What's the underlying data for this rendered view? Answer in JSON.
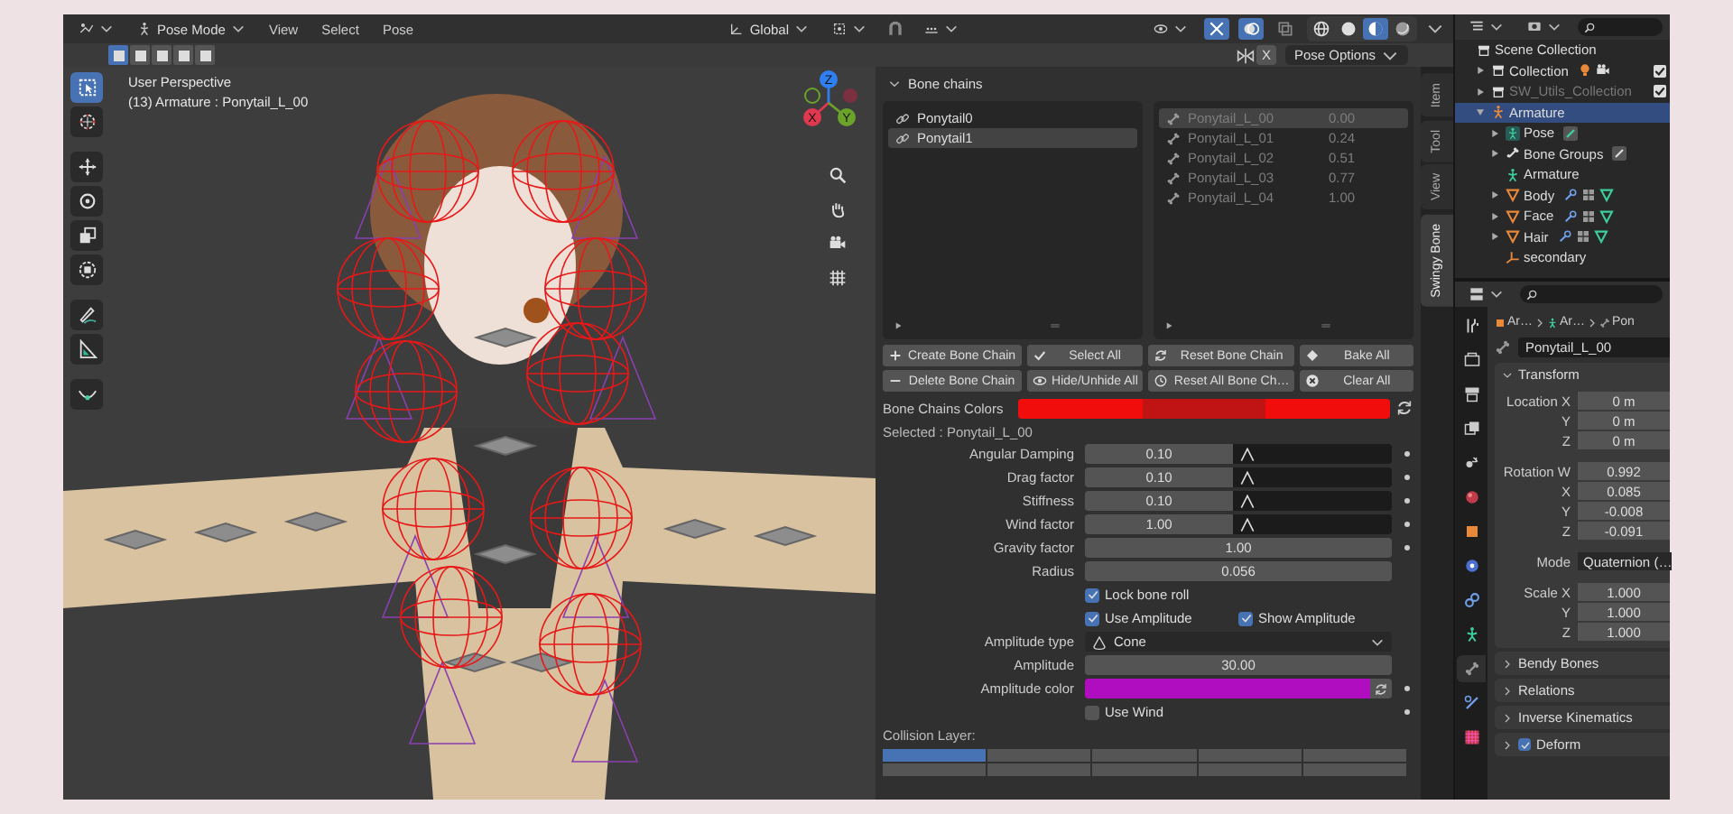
{
  "header": {
    "mode": "Pose Mode",
    "menus": [
      {
        "label": "View"
      },
      {
        "label": "Select"
      },
      {
        "label": "Pose"
      }
    ],
    "orientation": "Global",
    "shading": [
      {
        "kind": "wireframe",
        "selected": false
      },
      {
        "kind": "solid",
        "selected": false
      },
      {
        "kind": "material",
        "selected": true
      },
      {
        "kind": "rendered",
        "selected": false
      }
    ],
    "select_modes": [
      {
        "selected": true
      },
      {
        "selected": false
      },
      {
        "selected": false
      },
      {
        "selected": false
      },
      {
        "selected": false
      }
    ],
    "mirror": "X",
    "pose_options": "Pose Options"
  },
  "viewport": {
    "view_name": "User Perspective",
    "object_info": "(13) Armature : Ponytail_L_00",
    "tool_groups": [
      {
        "tools": [
          {
            "kind": "select",
            "selected": true
          },
          {
            "kind": "cursor",
            "selected": false
          }
        ]
      },
      {
        "tools": [
          {
            "kind": "move",
            "selected": false
          },
          {
            "kind": "rotate",
            "selected": false
          },
          {
            "kind": "scale",
            "selected": false
          },
          {
            "kind": "transform",
            "selected": false
          }
        ]
      },
      {
        "tools": [
          {
            "kind": "annotate",
            "selected": false
          },
          {
            "kind": "measure",
            "selected": false
          }
        ]
      },
      {
        "tools": [
          {
            "kind": "bend",
            "selected": false
          }
        ]
      }
    ],
    "gizmo": [
      {
        "label": "Z",
        "color": "#2f7ff0"
      },
      {
        "label": "X",
        "color": "#e0384f"
      },
      {
        "label": "Y",
        "color": "#6ba32a"
      }
    ]
  },
  "sidebar_tabs": [
    {
      "label": "Item",
      "selected": false
    },
    {
      "label": "Tool",
      "selected": false
    },
    {
      "label": "View",
      "selected": false
    },
    {
      "label": "Swingy Bone",
      "selected": true
    }
  ],
  "bone_chains": {
    "title": "Bone chains",
    "expanded": true,
    "chains": [
      {
        "name": "Ponytail0",
        "selected": false
      },
      {
        "name": "Ponytail1",
        "selected": true
      }
    ],
    "bones": [
      {
        "name": "Ponytail_L_00",
        "value": "0.00",
        "selected": true
      },
      {
        "name": "Ponytail_L_01",
        "value": "0.24",
        "selected": false
      },
      {
        "name": "Ponytail_L_02",
        "value": "0.51",
        "selected": false
      },
      {
        "name": "Ponytail_L_03",
        "value": "0.77",
        "selected": false
      },
      {
        "name": "Ponytail_L_04",
        "value": "1.00",
        "selected": false
      }
    ],
    "buttons": [
      {
        "label": "Create Bone Chain",
        "kind": "plus"
      },
      {
        "label": "Select All",
        "kind": "check"
      },
      {
        "label": "Reset Bone Chain",
        "kind": "reset"
      },
      {
        "label": "Bake All",
        "kind": "diamond"
      },
      {
        "label": "Delete Bone Chain",
        "kind": "minus"
      },
      {
        "label": "Hide/Unhide All",
        "kind": "eye"
      },
      {
        "label": "Reset All Bone Ch…",
        "kind": "reset_all"
      },
      {
        "label": "Clear All",
        "kind": "x_circle"
      }
    ],
    "colors_label": "Bone Chains Colors",
    "chain_colors": [
      {
        "color": "#f20d0d"
      },
      {
        "color": "#c01414"
      },
      {
        "color": "#f20d0d"
      }
    ],
    "selected_label": "Selected : Ponytail_L_00",
    "fields": [
      {
        "kind": "curve",
        "label": "Angular Damping",
        "value": "0.10",
        "keyframe": true
      },
      {
        "kind": "curve",
        "label": "Drag factor",
        "value": "0.10",
        "keyframe": true
      },
      {
        "kind": "curve",
        "label": "Stiffness",
        "value": "0.10",
        "keyframe": true
      },
      {
        "kind": "curve",
        "label": "Wind factor",
        "value": "1.00",
        "keyframe": true
      },
      {
        "kind": "number",
        "label": "Gravity factor",
        "value": "1.00",
        "keyframe": true
      },
      {
        "kind": "number",
        "label": "Radius",
        "value": "0.056",
        "keyframe": false
      },
      {
        "kind": "checks",
        "items": [
          {
            "label": "Lock bone roll",
            "checked": true
          }
        ],
        "keyframe": false
      },
      {
        "kind": "checks",
        "items": [
          {
            "label": "Use Amplitude",
            "checked": true
          },
          {
            "label": "Show Amplitude",
            "checked": true
          }
        ],
        "keyframe": false
      },
      {
        "kind": "dropdown",
        "label": "Amplitude type",
        "value": "Cone",
        "keyframe": false
      },
      {
        "kind": "number",
        "label": "Amplitude",
        "value": "30.00",
        "keyframe": false
      },
      {
        "kind": "color",
        "label": "Amplitude color",
        "color": "#b00cc0",
        "keyframe": true
      },
      {
        "kind": "checks",
        "items": [
          {
            "label": "Use Wind",
            "checked": false
          }
        ],
        "keyframe": true
      }
    ],
    "collision_label": "Collision Layer:",
    "collision_layers": [
      {
        "selected": true
      },
      {
        "selected": false
      },
      {
        "selected": false
      },
      {
        "selected": false
      },
      {
        "selected": false
      },
      {
        "selected": false
      },
      {
        "selected": false
      },
      {
        "selected": false
      },
      {
        "selected": false
      },
      {
        "selected": false
      }
    ]
  },
  "outliner": {
    "items": [
      {
        "label": "Scene Collection",
        "kind": "collection",
        "selected": false,
        "disabled": false,
        "children": [
          {
            "label": "Collection",
            "kind": "collection",
            "selected": false,
            "disabled": false,
            "expanded": false,
            "badges": [
              {
                "kind": "light"
              },
              {
                "kind": "camera"
              }
            ],
            "checked": true
          },
          {
            "label": "SW_Utils_Collection",
            "kind": "collection",
            "selected": false,
            "disabled": true,
            "expanded": false,
            "checked": true
          },
          {
            "label": "Armature",
            "kind": "armature",
            "selected": true,
            "disabled": false,
            "expanded": true,
            "children": [
              {
                "label": "Pose",
                "kind": "pose",
                "selected": false,
                "disabled": false,
                "expanded": false,
                "badges": [
                  {
                    "kind": "bone"
                  }
                ]
              },
              {
                "label": "Bone Groups",
                "kind": "bone_group",
                "selected": false,
                "disabled": false,
                "expanded": false,
                "badges": [
                  {
                    "kind": "bone_group"
                  }
                ]
              },
              {
                "label": "Armature",
                "kind": "armature_data",
                "selected": false,
                "disabled": false
              },
              {
                "label": "Body",
                "kind": "mesh",
                "selected": false,
                "disabled": false,
                "expanded": false,
                "badges": [
                  {
                    "kind": "wrench"
                  },
                  {
                    "kind": "vertex_groups"
                  },
                  {
                    "kind": "mesh_data"
                  }
                ]
              },
              {
                "label": "Face",
                "kind": "mesh",
                "selected": false,
                "disabled": false,
                "expanded": false,
                "badges": [
                  {
                    "kind": "wrench"
                  },
                  {
                    "kind": "vertex_groups"
                  },
                  {
                    "kind": "mesh_data"
                  }
                ]
              },
              {
                "label": "Hair",
                "kind": "mesh",
                "selected": false,
                "disabled": false,
                "expanded": false,
                "badges": [
                  {
                    "kind": "wrench"
                  },
                  {
                    "kind": "vertex_groups"
                  },
                  {
                    "kind": "mesh_data"
                  }
                ]
              },
              {
                "label": "secondary",
                "kind": "empty",
                "selected": false,
                "disabled": false
              }
            ]
          }
        ]
      }
    ]
  },
  "properties": {
    "tabs": [
      {
        "kind": "tool",
        "selected": false
      },
      {
        "kind": "render",
        "selected": false
      },
      {
        "kind": "output",
        "selected": false
      },
      {
        "kind": "view_layer",
        "selected": false
      },
      {
        "kind": "scene",
        "selected": false
      },
      {
        "kind": "world",
        "selected": false
      },
      {
        "kind": "object",
        "selected": false
      },
      {
        "kind": "physics",
        "selected": false
      },
      {
        "kind": "constraint",
        "selected": false
      },
      {
        "kind": "armature_data",
        "selected": false
      },
      {
        "kind": "bone",
        "selected": true
      },
      {
        "kind": "bone_constraint",
        "selected": false
      },
      {
        "kind": "texture",
        "selected": false
      }
    ],
    "breadcrumb": [
      {
        "label": "Ar…",
        "kind": "object"
      },
      {
        "label": "Ar…",
        "kind": "armature_data"
      },
      {
        "label": "Pon",
        "kind": "bone"
      }
    ],
    "bone_name": "Ponytail_L_00",
    "transform": {
      "title": "Transform",
      "expanded": true,
      "groups": [
        [
          {
            "label": "Location X",
            "value": "0 m",
            "kind": "number"
          },
          {
            "label": "Y",
            "value": "0 m",
            "kind": "number"
          },
          {
            "label": "Z",
            "value": "0 m",
            "kind": "number"
          }
        ],
        [
          {
            "label": "Rotation W",
            "value": "0.992",
            "kind": "number"
          },
          {
            "label": "X",
            "value": "0.085",
            "kind": "number"
          },
          {
            "label": "Y",
            "value": "-0.008",
            "kind": "number"
          },
          {
            "label": "Z",
            "value": "-0.091",
            "kind": "number"
          }
        ],
        [
          {
            "label": "Mode",
            "value": "Quaternion (…",
            "kind": "dropdown"
          }
        ],
        [
          {
            "label": "Scale X",
            "value": "1.000",
            "kind": "number"
          },
          {
            "label": "Y",
            "value": "1.000",
            "kind": "number"
          },
          {
            "label": "Z",
            "value": "1.000",
            "kind": "number"
          }
        ]
      ]
    },
    "panels": [
      {
        "title": "Bendy Bones",
        "expanded": false,
        "kind": "plain"
      },
      {
        "title": "Relations",
        "expanded": false,
        "kind": "plain"
      },
      {
        "title": "Inverse Kinematics",
        "expanded": false,
        "kind": "plain"
      },
      {
        "title": "Deform",
        "expanded": false,
        "kind": "toggle",
        "checked": true
      }
    ]
  }
}
